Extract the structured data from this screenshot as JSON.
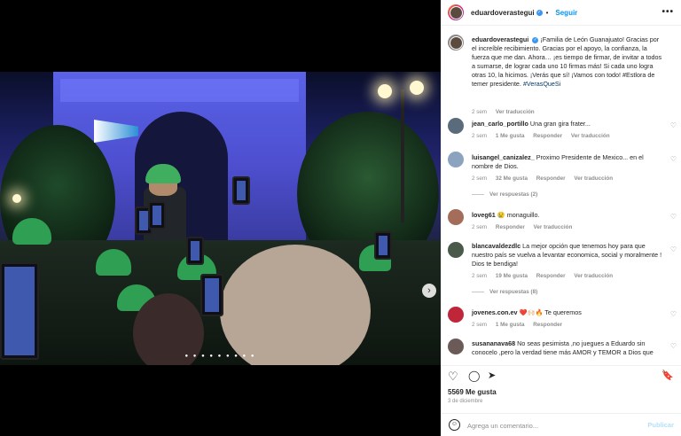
{
  "header": {
    "username": "eduardoverastegui",
    "follow_label": "Seguir",
    "separator": "•",
    "more_label": "•••"
  },
  "caption": {
    "username": "eduardoverastegui",
    "text": "¡Familia de León Guanajuato! Gracias por el increíble recibimiento. Gracias por el apoyo, la confianza, la fuerza que me dan. Ahora… ¡es tiempo de firmar, de invitar a todos a sumarse, de lograr cada uno 10 firmas más! Si cada uno logra otras 10, la hicimos. ¡Verás que sí! ¡Vamos con todo! #Estlora de temer presidente.",
    "hashtag": "#VerasQueSi",
    "time": "2 sem",
    "translate": "Ver traducción"
  },
  "comments": [
    {
      "user": "jean_carlo_portillo",
      "text": "Una gran gira frater...",
      "time": "2 sem",
      "likes": "1 Me gusta",
      "reply": "Responder",
      "translate": "Ver traducción",
      "replies": ""
    },
    {
      "user": "luisangel_canizalez_",
      "text": "Proximo Presidente de Mexico... en el nombre de Dios.",
      "time": "2 sem",
      "likes": "32 Me gusta",
      "reply": "Responder",
      "translate": "Ver traducción",
      "replies": "Ver respuestas (2)"
    },
    {
      "user": "loveg61",
      "text": "😢 monaguillo.",
      "time": "2 sem",
      "likes": "",
      "reply": "Responder",
      "translate": "Ver traducción",
      "replies": ""
    },
    {
      "user": "blancavaldezdlc",
      "text": "La mejor opción que tenemos hoy para que nuestro país se vuelva a levantar economica, social y moralmente ! Dios te bendiga!",
      "time": "2 sem",
      "likes": "19 Me gusta",
      "reply": "Responder",
      "translate": "Ver traducción",
      "replies": "Ver respuestas (8)"
    },
    {
      "user": "jovenes.con.ev",
      "text": "❤️🙌🏻🔥 Te queremos",
      "time": "2 sem",
      "likes": "1 Me gusta",
      "reply": "Responder",
      "translate": "",
      "replies": ""
    },
    {
      "user": "susananava68",
      "text": "No seas pesimista ,no juegues a Eduardo sin conocelo ,pero la verdad tiene más AMOR y TEMOR a Dios que",
      "time": "",
      "likes": "",
      "reply": "",
      "translate": "",
      "replies": ""
    }
  ],
  "footer": {
    "likes": "5569 Me gusta",
    "date": "3 de diciembre",
    "comment_placeholder": "Agrega un comentario...",
    "publish_label": "Publicar"
  },
  "carousel": {
    "dots": "● ● ● ● ● ● ● ● ●",
    "next_icon": "›"
  },
  "icons": {
    "heart": "♡",
    "comment": "◯",
    "share": "➤",
    "save": "🔖",
    "emoji": "☺"
  },
  "colors": {
    "accent": "#0095f6",
    "verified": "#3897f0",
    "hashtag": "#00376b"
  }
}
